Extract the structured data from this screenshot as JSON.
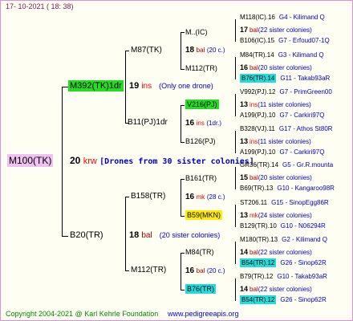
{
  "header": {
    "date": "17-  10-2021  (  18:  38)"
  },
  "root": {
    "label": "M100(TK)",
    "count": "20",
    "word": "krw",
    "note": "[Drones from 30 sister colonies]"
  },
  "gen2": [
    {
      "label": "M392(TK)1dr",
      "count": "19",
      "word": "ins",
      "note": "(Only one drone)"
    },
    {
      "label": "B20(TR)",
      "count": "18",
      "word": "bal",
      "note": "(20 sister colonies)"
    }
  ],
  "gen3": [
    {
      "label": "M87(TK)"
    },
    {
      "label": "B11(PJ)1dr"
    },
    {
      "label": "B158(TR)"
    },
    {
      "label": "M112(TR)"
    }
  ],
  "gen4": [
    {
      "label": "M..(IC)"
    },
    {
      "label": "18",
      "word": "bal",
      "note": "(20 c.)"
    },
    {
      "label": "M112(TR)"
    },
    {
      "label": "V216(PJ)"
    },
    {
      "label": "16",
      "word": "ins",
      "note": "(1dr.)"
    },
    {
      "label": "B126(PJ)"
    },
    {
      "label": "B161(TR)"
    },
    {
      "label": "16",
      "word": "mk",
      "note": "(28 c.)"
    },
    {
      "label": "B59(MKN)"
    },
    {
      "label": "M84(TR)"
    },
    {
      "label": "16",
      "word": "bal",
      "note": "(20 c.)"
    },
    {
      "label": "B76(TR)"
    }
  ],
  "gen5": [
    {
      "name": "M118(IC).16",
      "note": "G4 - Kilimand Q"
    },
    {
      "count": "17",
      "word": "bal",
      "note": "(22 sister colonies)"
    },
    {
      "name": "B106(IC).15",
      "note": "G7 - Erfoud07-1Q"
    },
    {
      "name": "M84(TR).14",
      "note": "G3 - Kilimand Q"
    },
    {
      "count": "16",
      "word": "bal",
      "note": "(20 sister colonies)"
    },
    {
      "name": "B76(TR).14",
      "note": "G11 - Takab93aR"
    },
    {
      "name": "V992(PJ).12",
      "note": "G7 - PrimGreen00"
    },
    {
      "count": "13",
      "word": "ins",
      "note": "(11 sister colonies)"
    },
    {
      "name": "A199(PJ).10",
      "note": "G7 - Carkiri97Q"
    },
    {
      "name": "B328(VJ).11",
      "note": "G17 - Athos St80R"
    },
    {
      "count": "13",
      "word": "ins",
      "note": "(11 sister colonies)"
    },
    {
      "name": "A199(PJ).10",
      "note": "G7 - Carkiri97Q"
    },
    {
      "name": "GR36(TR).14",
      "note": "G5 - Gr.R.mounta"
    },
    {
      "count": "15",
      "word": "bal",
      "note": "(20 sister colonies)"
    },
    {
      "name": "B69(TR).13",
      "note": "G10 - Kangaroo98R"
    },
    {
      "name": "ST206.11",
      "note": "G15 - SinopEgg86R"
    },
    {
      "count": "13",
      "word": "mk",
      "note": "(24 sister colonies)"
    },
    {
      "name": "B129(TR).10",
      "note": "G10 - N06294R"
    },
    {
      "name": "M180(TR).13",
      "note": "G2 - Kilimand Q"
    },
    {
      "count": "14",
      "word": "bal",
      "note": "(22 sister colonies)"
    },
    {
      "name": "B54(TR).12",
      "note": "G26 - Sinop62R"
    },
    {
      "name": "B79(TR).12",
      "note": "G10 - Takab93aR"
    },
    {
      "count": "14",
      "word": "bal",
      "note": "(22 sister colonies)"
    },
    {
      "name": "B54(TR).12",
      "note": "G26 - Sinop62R"
    }
  ],
  "footer": {
    "copyright": "Copyright 2004-2021 @ Karl Kehrle Foundation",
    "url": "www.pedigreeapis.org"
  },
  "colors": {
    "drone_word": "#b00000",
    "root_word": "#ff0000",
    "note_blue": "#0000c0",
    "pink": "#f0c0f0",
    "green": "#22dd22",
    "yellow": "#ffee00",
    "cyan": "#22dddd",
    "footer_green": "#008800"
  }
}
